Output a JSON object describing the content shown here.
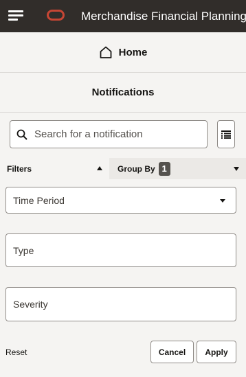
{
  "header": {
    "app_title": "Merchandise Financial Planning (mf",
    "menu_icon": "hamburger-icon",
    "logo": "oracle-logo",
    "logo_color": "#c74634",
    "background": "#312d2a"
  },
  "home": {
    "icon": "home-icon",
    "label": "Home"
  },
  "panel": {
    "title": "Notifications"
  },
  "search": {
    "placeholder": "Search for a notification",
    "value": "",
    "icon": "search-icon"
  },
  "list_button": {
    "icon": "list-view-icon"
  },
  "tabs": {
    "filters_label": "Filters",
    "group_by_label": "Group By",
    "group_by_count": "1"
  },
  "filters": {
    "time_period": "Time Period",
    "type": "Type",
    "severity": "Severity"
  },
  "actions": {
    "reset": "Reset",
    "cancel": "Cancel",
    "apply": "Apply"
  }
}
